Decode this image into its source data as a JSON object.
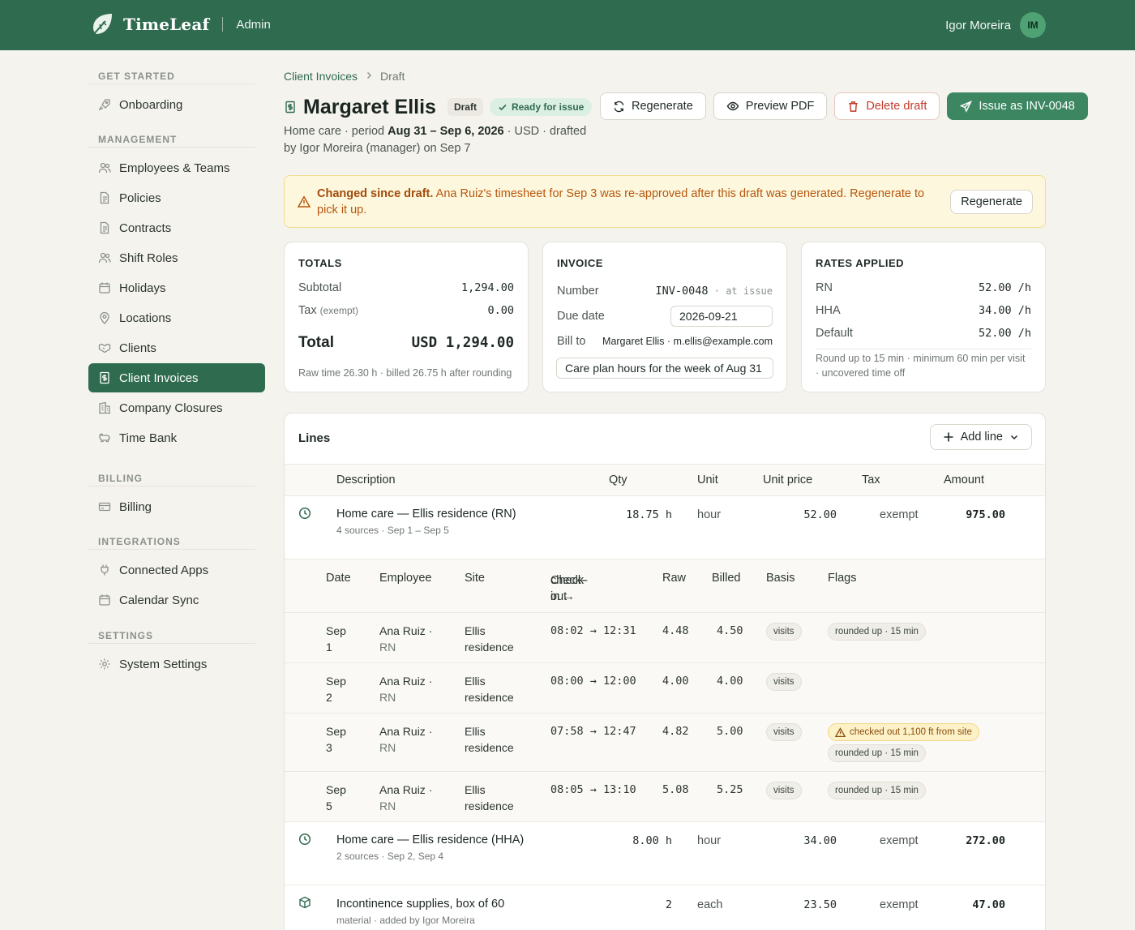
{
  "brand": {
    "name": "TimeLeaf",
    "section": "Admin"
  },
  "user": {
    "name": "Igor Moreira",
    "initials": "IM"
  },
  "sidebar": {
    "sections": [
      {
        "title": "GET STARTED",
        "items": [
          {
            "label": "Onboarding",
            "icon": "rocket-icon"
          }
        ]
      },
      {
        "title": "MANAGEMENT",
        "items": [
          {
            "label": "Employees & Teams",
            "icon": "users-icon"
          },
          {
            "label": "Policies",
            "icon": "document-icon"
          },
          {
            "label": "Contracts",
            "icon": "document-icon"
          },
          {
            "label": "Shift Roles",
            "icon": "users-icon"
          },
          {
            "label": "Holidays",
            "icon": "calendar-icon"
          },
          {
            "label": "Locations",
            "icon": "pin-icon"
          },
          {
            "label": "Clients",
            "icon": "handshake-icon"
          },
          {
            "label": "Client Invoices",
            "icon": "invoice-icon",
            "active": true
          },
          {
            "label": "Company Closures",
            "icon": "building-icon"
          },
          {
            "label": "Time Bank",
            "icon": "piggy-bank-icon"
          }
        ]
      },
      {
        "title": "BILLING",
        "items": [
          {
            "label": "Billing",
            "icon": "card-icon"
          }
        ]
      },
      {
        "title": "INTEGRATIONS",
        "items": [
          {
            "label": "Connected Apps",
            "icon": "plug-icon"
          },
          {
            "label": "Calendar Sync",
            "icon": "calendar-icon"
          }
        ]
      },
      {
        "title": "SETTINGS",
        "items": [
          {
            "label": "System Settings",
            "icon": "gear-icon"
          }
        ]
      }
    ]
  },
  "breadcrumb": {
    "parent": "Client Invoices",
    "current": "Draft"
  },
  "header": {
    "title": "Margaret Ellis",
    "status": "Draft",
    "ready": "Ready for issue",
    "actions": {
      "regenerate": "Regenerate",
      "preview": "Preview PDF",
      "delete": "Delete draft",
      "issue": "Issue as INV-0048"
    },
    "subtitle": {
      "prefix": "Home care · period ",
      "period": "Aug 31 – Sep 6, 2026",
      "suffix": " · USD · drafted by Igor Moreira (manager) on Sep 7"
    }
  },
  "alert": {
    "strong": "Changed since draft.",
    "text": " Ana Ruiz's timesheet for Sep 3 was re-approved after this draft was generated. Regenerate to pick it up.",
    "button": "Regenerate"
  },
  "totals": {
    "title": "TOTALS",
    "subtotal_label": "Subtotal",
    "subtotal": "1,294.00",
    "tax_label": "Tax",
    "tax_note": "(exempt)",
    "tax": "0.00",
    "total_label": "Total",
    "total": "USD 1,294.00",
    "footnote": "Raw time 26.30 h · billed 26.75 h after rounding"
  },
  "invoice": {
    "title": "INVOICE",
    "number_label": "Number",
    "number": "INV-0048",
    "number_note": " · at issue",
    "due_label": "Due date",
    "due": "2026-09-21",
    "bill_label": "Bill to",
    "bill_to": "Margaret Ellis · m.ellis@example.com",
    "memo": "Care plan hours for the week of Aug 31"
  },
  "rates": {
    "title": "RATES APPLIED",
    "items": [
      {
        "label": "RN",
        "value": "52.00 /h"
      },
      {
        "label": "HHA",
        "value": "34.00 /h"
      },
      {
        "label": "Default",
        "value": "52.00 /h"
      }
    ],
    "footnote": "Round up to 15 min · minimum 60 min per visit · uncovered time off"
  },
  "lines": {
    "title": "Lines",
    "add_label": "Add line",
    "columns": {
      "description": "Description",
      "qty": "Qty",
      "unit": "Unit",
      "unit_price": "Unit price",
      "tax": "Tax",
      "amount": "Amount"
    },
    "items": [
      {
        "desc": "Home care — Ellis residence (RN)",
        "meta": "4 sources · Sep 1 – Sep 5",
        "qty": "18.75 h",
        "unit": "hour",
        "price": "52.00",
        "tax": "exempt",
        "amount": "975.00",
        "icon": "clock-icon"
      },
      {
        "desc": "Home care — Ellis residence (HHA)",
        "meta": "2 sources · Sep 2, Sep 4",
        "qty": "8.00 h",
        "unit": "hour",
        "price": "34.00",
        "tax": "exempt",
        "amount": "272.00",
        "icon": "clock-icon"
      },
      {
        "desc": "Incontinence supplies, box of 60",
        "meta": "material · added by Igor Moreira",
        "qty": "2",
        "unit": "each",
        "price": "23.50",
        "tax": "exempt",
        "amount": "47.00",
        "icon": "box-icon"
      }
    ],
    "sources": {
      "columns": {
        "date": "Date",
        "employee": "Employee",
        "site": "Site",
        "checkinout_1": "Check-in →",
        "checkinout_2": "check-out",
        "raw": "Raw",
        "billed": "Billed",
        "basis": "Basis",
        "flags": "Flags"
      },
      "rows": [
        {
          "date1": "Sep",
          "date2": "1",
          "emp": "Ana Ruiz ·",
          "role": "RN",
          "site1": "Ellis",
          "site2": "residence",
          "time": "08:02 → 12:31",
          "raw": "4.48",
          "billed": "4.50",
          "basis": "visits",
          "flag": "rounded up · 15 min"
        },
        {
          "date1": "Sep",
          "date2": "2",
          "emp": "Ana Ruiz ·",
          "role": "RN",
          "site1": "Ellis",
          "site2": "residence",
          "time": "08:00 → 12:00",
          "raw": "4.00",
          "billed": "4.00",
          "basis": "visits"
        },
        {
          "date1": "Sep",
          "date2": "3",
          "emp": "Ana Ruiz ·",
          "role": "RN",
          "site1": "Ellis",
          "site2": "residence",
          "time": "07:58 → 12:47",
          "raw": "4.82",
          "billed": "5.00",
          "basis": "visits",
          "warn": "checked out 1,100 ft from site",
          "flag": "rounded up · 15 min"
        },
        {
          "date1": "Sep",
          "date2": "5",
          "emp": "Ana Ruiz ·",
          "role": "RN",
          "site1": "Ellis",
          "site2": "residence",
          "time": "08:05 → 13:10",
          "raw": "5.08",
          "billed": "5.25",
          "basis": "visits",
          "flag": "rounded up · 15 min"
        }
      ]
    }
  }
}
